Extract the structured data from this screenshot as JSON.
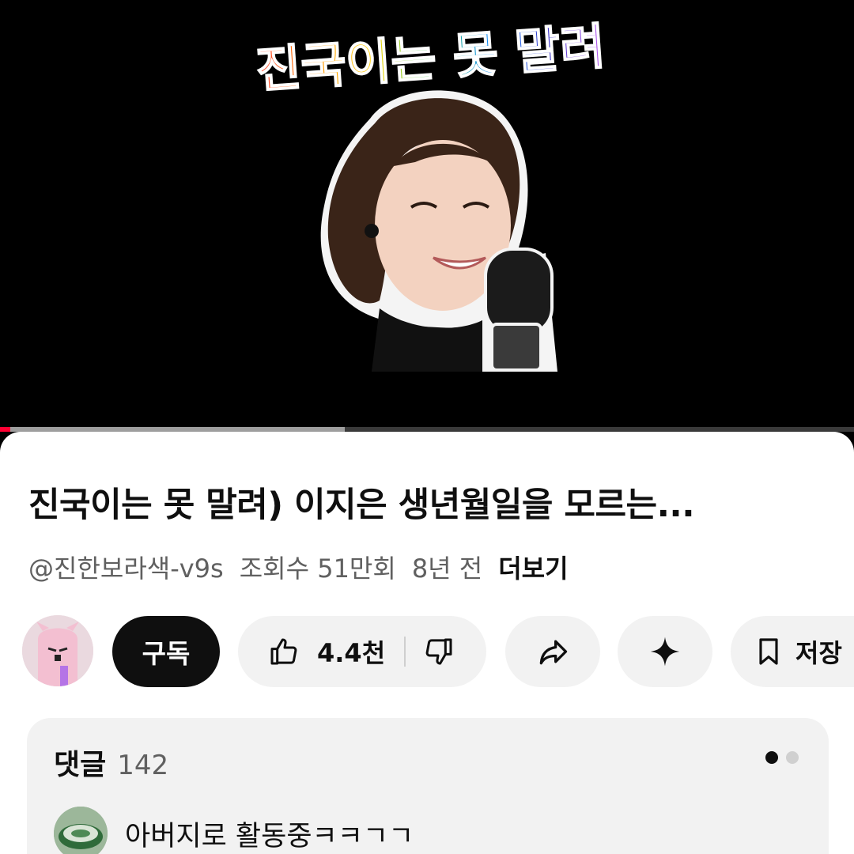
{
  "video": {
    "overlay_text": "진국이는 못 말려",
    "progress_played": 0.012,
    "progress_buffered": 0.404
  },
  "details": {
    "title": "진국이는 못 말려) 이지은 생년월일을 모르는...",
    "channel": "@진한보라색-v9s",
    "views": "조회수 51만회",
    "age": "8년 전",
    "more": "더보기"
  },
  "actions": {
    "subscribe": "구독",
    "likes": "4.4천",
    "save": "저장",
    "icons": [
      "thumb-up-icon",
      "thumb-down-icon",
      "share-icon",
      "sparkle-icon",
      "bookmark-icon"
    ]
  },
  "comments": {
    "label": "댓글",
    "count": "142",
    "first_comment": "아버지로 활동중ㅋㅋㄱㄱ"
  },
  "colors": {
    "accent": "#ff0033",
    "text_primary": "#0f0f0f",
    "text_secondary": "#606060",
    "pill_bg": "#f2f2f2",
    "dot_active": "#0f0f0f",
    "dot_inactive": "#d0d0d0"
  }
}
